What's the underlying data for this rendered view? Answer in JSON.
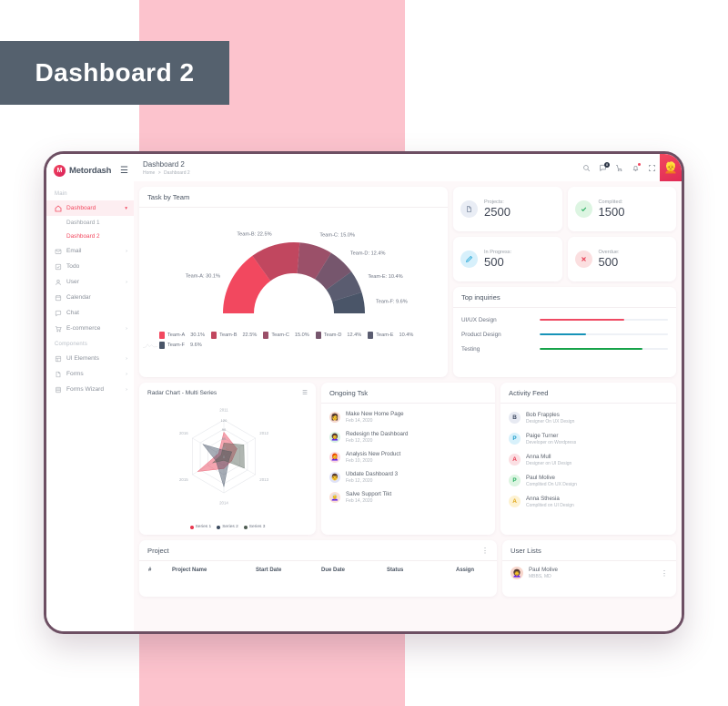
{
  "poster": {
    "title": "Dashboard 2",
    "badge_color": "#55616e",
    "band_color": "#fcc3cd"
  },
  "brand": {
    "name": "Metordash",
    "logo_letter": "M",
    "menu_icon": "hamburger-icon"
  },
  "sidebar": {
    "sections": [
      {
        "label": "Main",
        "items": [
          {
            "label": "Dashboard",
            "icon": "home-icon",
            "active": true,
            "caret": "chevron-down-icon",
            "children": [
              {
                "label": "Dashboard 1",
                "active": false
              },
              {
                "label": "Dashboard 2",
                "active": true
              }
            ]
          },
          {
            "label": "Email",
            "icon": "mail-icon",
            "caret": "chevron-right-icon"
          },
          {
            "label": "Todo",
            "icon": "check-square-icon",
            "caret": ""
          },
          {
            "label": "User",
            "icon": "user-icon",
            "caret": "chevron-right-icon"
          },
          {
            "label": "Calendar",
            "icon": "calendar-icon",
            "caret": ""
          },
          {
            "label": "Chat",
            "icon": "chat-icon",
            "caret": ""
          },
          {
            "label": "E-commerce",
            "icon": "cart-icon",
            "caret": "chevron-right-icon"
          }
        ]
      },
      {
        "label": "Components",
        "items": [
          {
            "label": "UI Elements",
            "icon": "grid-icon",
            "caret": "chevron-right-icon"
          },
          {
            "label": "Forms",
            "icon": "file-icon",
            "caret": "chevron-right-icon"
          },
          {
            "label": "Forms Wizard",
            "icon": "list-icon",
            "caret": "chevron-right-icon"
          }
        ]
      }
    ]
  },
  "header": {
    "title": "Dashboard 2",
    "breadcrumb": {
      "home": "Home",
      "separator": ">",
      "current": "Dashboard 2"
    },
    "icons": [
      {
        "name": "search-icon"
      },
      {
        "name": "message-icon",
        "badge": "8"
      },
      {
        "name": "cart-icon"
      },
      {
        "name": "bell-icon",
        "dot": true
      },
      {
        "name": "fullscreen-icon"
      }
    ],
    "avatar": "user-avatar"
  },
  "task_by_team": {
    "title": "Task by Team"
  },
  "chart_data": [
    {
      "type": "pie",
      "title": "Task by Team",
      "variant": "semi-donut-gauge",
      "categories": [
        "Team-A",
        "Team-B",
        "Team-C",
        "Team-D",
        "Team-E",
        "Team-F"
      ],
      "values": [
        30.1,
        22.5,
        15.0,
        12.4,
        10.4,
        9.6
      ],
      "value_labels": [
        "30.1%",
        "22.5%",
        "15.0%",
        "12.4%",
        "10.4%",
        "9.6%"
      ],
      "outside_labels": [
        "Team-A: 30.1%",
        "Team-B: 22.5%",
        "Team-C: 15.0%",
        "Team-D: 12.4%",
        "Team-E: 10.4%",
        "Team-F: 9.6%"
      ],
      "colors": [
        "#f2485f",
        "#c1475f",
        "#9b5069",
        "#76566d",
        "#5a5c70",
        "#4a5568"
      ],
      "legend_position": "bottom"
    },
    {
      "type": "line",
      "variant": "radar",
      "title": "Radar Chart - Multi Series",
      "categories": [
        "2011",
        "2012",
        "2013",
        "2014",
        "2015",
        "2016"
      ],
      "rticks": [
        "0",
        "30",
        "60",
        "90",
        "120"
      ],
      "ylim": [
        0,
        120
      ],
      "grid": true,
      "legend_position": "bottom",
      "series": [
        {
          "name": "Series 1",
          "color": "#e8384f",
          "values": [
            80,
            50,
            30,
            40,
            100,
            20
          ]
        },
        {
          "name": "Series 2",
          "color": "#3b4a5e",
          "values": [
            20,
            30,
            20,
            100,
            30,
            80
          ]
        },
        {
          "name": "Series 3",
          "color": "#4f5d53",
          "values": [
            44,
            76,
            78,
            13,
            43,
            10
          ]
        }
      ]
    }
  ],
  "stats": [
    {
      "label": "Projects:",
      "value": "2500",
      "icon": "document-icon",
      "icon_bg": "#e9edf5",
      "icon_color": "#7c8aa0"
    },
    {
      "label": "Complited:",
      "value": "1500",
      "icon": "check-icon",
      "icon_bg": "#ddf5e2",
      "icon_color": "#27ae60"
    },
    {
      "label": "In Progress:",
      "value": "500",
      "icon": "pencil-icon",
      "icon_bg": "#d7f0fb",
      "icon_color": "#2aa9d8"
    },
    {
      "label": "Overdue:",
      "value": "500",
      "icon": "close-icon",
      "icon_bg": "#fbdfe0",
      "icon_color": "#e8384f"
    }
  ],
  "top_inquiries": {
    "title": "Top inquiries",
    "rows": [
      {
        "label": "UI/UX Design",
        "percent": 66,
        "color": "#ef4a63"
      },
      {
        "label": "Product Design",
        "percent": 36,
        "color": "#1793b8"
      },
      {
        "label": "Testing",
        "percent": 80,
        "color": "#17a34a"
      }
    ]
  },
  "ongoing_tsk": {
    "title": "Ongoing Tsk",
    "items": [
      {
        "title": "Make New Home Page",
        "date": "Feb 14, 2020",
        "avatar_bg": "#f7d9cf",
        "avatar_glyph": "👩"
      },
      {
        "title": "Redesign the Dashboard",
        "date": "Feb 12, 2020",
        "avatar_bg": "#d6f0e2",
        "avatar_glyph": "👩‍🦱"
      },
      {
        "title": "Analysis New Product",
        "date": "Feb 10, 2020",
        "avatar_bg": "#fbd9e2",
        "avatar_glyph": "👩‍🦰"
      },
      {
        "title": "Ubdate Dashboard 3",
        "date": "Feb 12, 2020",
        "avatar_bg": "#dfe2f7",
        "avatar_glyph": "👨"
      },
      {
        "title": "Salve Support Tikt",
        "date": "Feb 14, 2020",
        "avatar_bg": "#fbdfd6",
        "avatar_glyph": "👩‍🦳"
      }
    ]
  },
  "activity_feed": {
    "title": "Activity Feed",
    "items": [
      {
        "initial": "B",
        "name": "Bob Frapples",
        "sub": "Designer On UX Design",
        "bg": "#e7eaf2",
        "fg": "#3f4b63"
      },
      {
        "initial": "P",
        "name": "Paige Turner",
        "sub": "Developer on Wordpress",
        "bg": "#d8f1fb",
        "fg": "#1f9ecb"
      },
      {
        "initial": "A",
        "name": "Anna Mull",
        "sub": "Designer on UI Design",
        "bg": "#fbdfe3",
        "fg": "#e8384f"
      },
      {
        "initial": "P",
        "name": "Paul Molive",
        "sub": "Complited On UX Design",
        "bg": "#ddf5e2",
        "fg": "#27ae60"
      },
      {
        "initial": "A",
        "name": "Anna Sthesia",
        "sub": "Complited on UI Design",
        "bg": "#fdf2d2",
        "fg": "#e0a81a"
      }
    ]
  },
  "project_table": {
    "title": "Project",
    "menu_icon": "more-vertical-icon",
    "columns": [
      "#",
      "Project Name",
      "Start Date",
      "Due Date",
      "Status",
      "Assign"
    ]
  },
  "user_lists": {
    "title": "User Lists",
    "items": [
      {
        "name": "Paul Molive",
        "sub": "MBBS, MD",
        "avatar_bg": "#f8d7cd",
        "avatar_glyph": "👩‍🦱",
        "menu_icon": "more-vertical-icon"
      }
    ]
  }
}
